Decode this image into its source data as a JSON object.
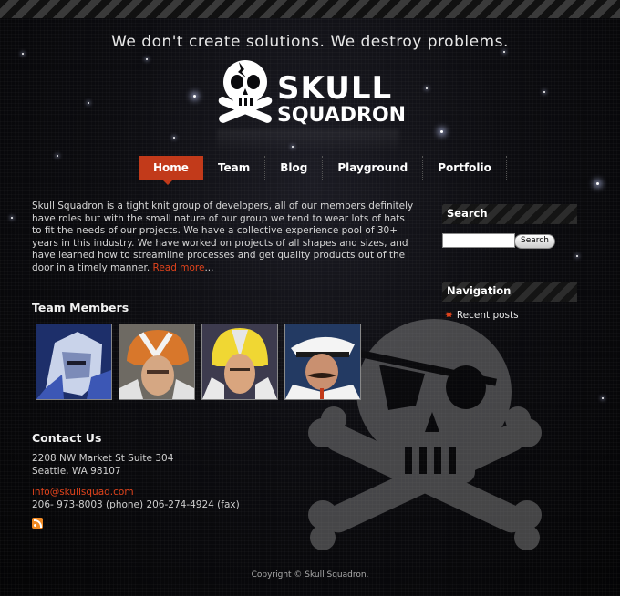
{
  "tagline": "We don't create solutions. We destroy problems.",
  "logo": {
    "line1": "SKULL",
    "line2": "SQUADRON"
  },
  "nav": [
    {
      "label": "Home",
      "active": true
    },
    {
      "label": "Team",
      "active": false
    },
    {
      "label": "Blog",
      "active": false
    },
    {
      "label": "Playground",
      "active": false
    },
    {
      "label": "Portfolio",
      "active": false
    }
  ],
  "intro": {
    "text": "Skull Squadron is a tight knit group of developers, all of our members definitely have roles but with the small nature of our group we tend to wear lots of hats to fit the needs of our projects. We have a collective experience pool of 30+ years in this industry. We have worked on projects of all shapes and sizes, and have learned how to streamline processes and get quality products out of the door in a timely manner.",
    "read_more": "Read more",
    "ellipsis": "..."
  },
  "team": {
    "heading": "Team Members"
  },
  "contact": {
    "heading": "Contact Us",
    "address_line1": "2208 NW Market St Suite 304",
    "address_line2": "Seattle, WA 98107",
    "email": "info@skullsquad.com",
    "phone": "206- 973-8003 (phone)   206-274-4924 (fax)"
  },
  "sidebar": {
    "search_title": "Search",
    "search_placeholder": "",
    "search_button": "Search",
    "navigation_title": "Navigation",
    "recent_posts": "Recent posts"
  },
  "footer": {
    "copyright": "Copyright © Skull Squadron."
  },
  "colors": {
    "accent": "#c23a1a",
    "link": "#e0431c",
    "background": "#07070a"
  }
}
